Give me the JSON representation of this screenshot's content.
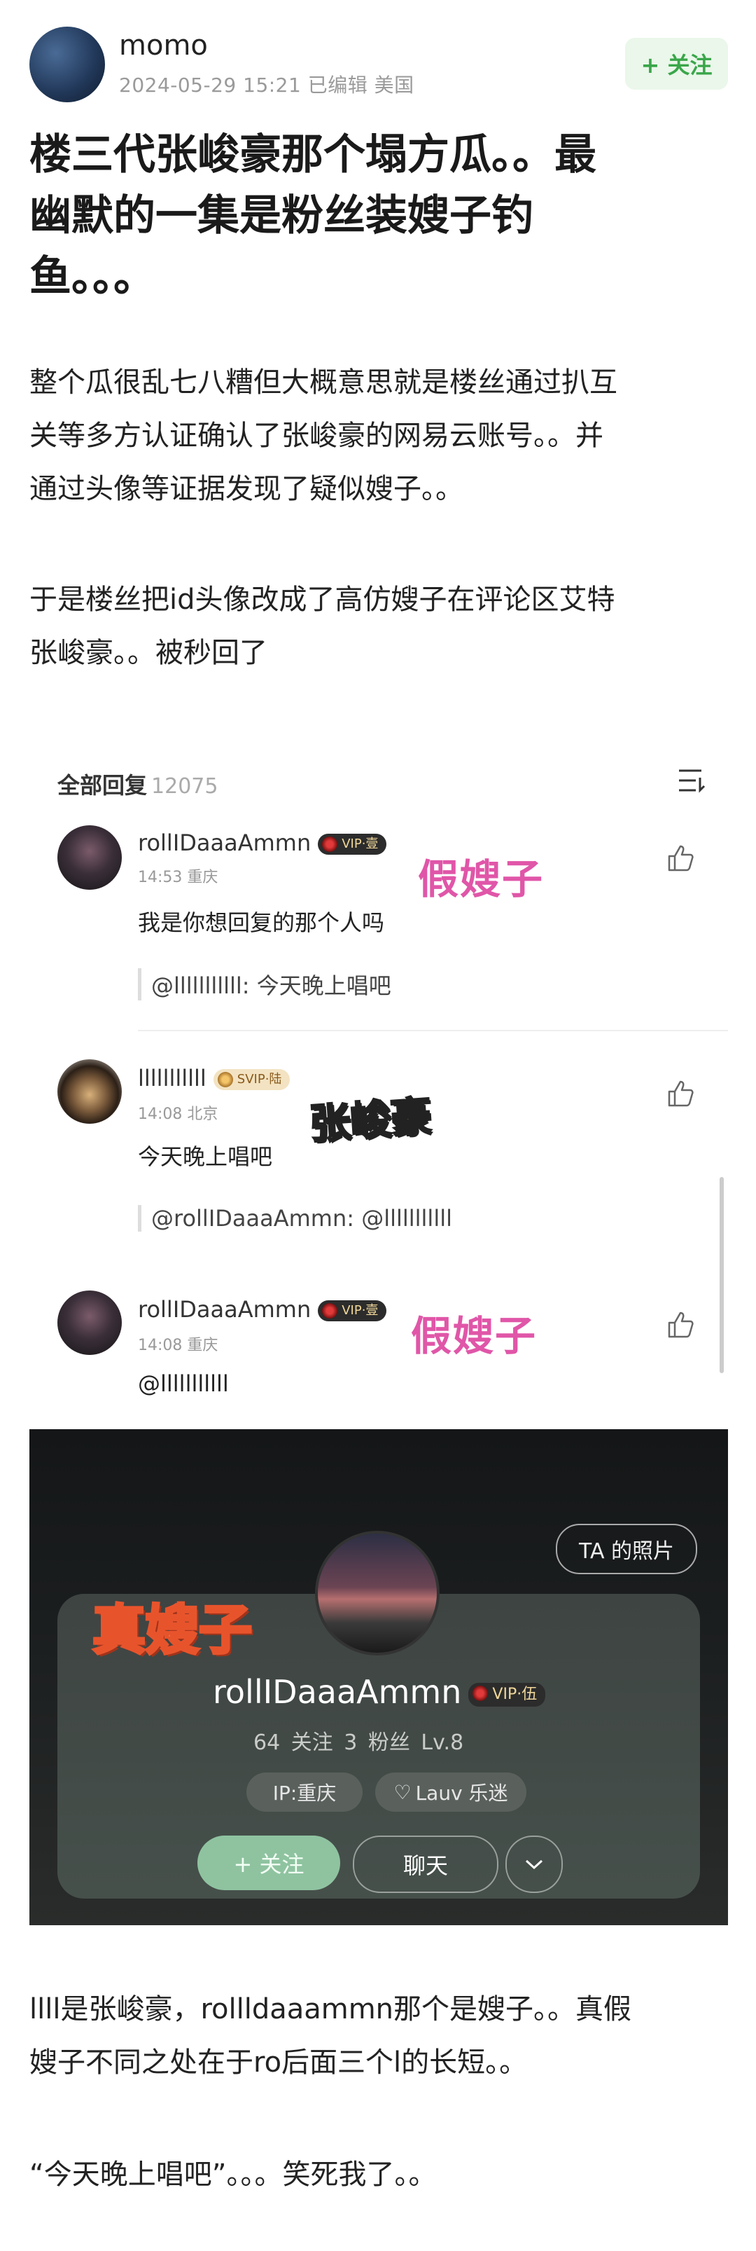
{
  "header": {
    "username": "momo",
    "meta": "2024-05-29 15:21 已编辑 美国",
    "follow_label": "+ 关注"
  },
  "post": {
    "title_lines": [
      "楼三代张峻豪那个塌方瓜。。最",
      "幽默的一集是粉丝装嫂子钓",
      "鱼。。。"
    ],
    "para1_lines": [
      "整个瓜很乱七八糟但大概意思就是楼丝通过扒互",
      "关等多方认证确认了张峻豪的网易云账号。。并",
      "通过头像等证据发现了疑似嫂子。。"
    ],
    "para2_lines": [
      "于是楼丝把id头像改成了高仿嫂子在评论区艾特",
      "张峻豪。。被秒回了"
    ],
    "para3_lines": [
      "llll是张峻豪，rollldaaammn那个是嫂子。。真假",
      "嫂子不同之处在于ro后面三个l的长短。。"
    ],
    "para4": "“今天晚上唱吧”。。。笑死我了。。"
  },
  "comments": {
    "header_label": "全部回复",
    "count": "12075",
    "items": [
      {
        "name": "rollIDaaaAmmn",
        "vip": "VIP·壹",
        "time": "14:53 重庆",
        "text": "我是你想回复的那个人吗",
        "quote": "@lllllllllll: 今天晚上唱吧",
        "tag": "假嫂子"
      },
      {
        "name": "lllllllllll",
        "vip": "SVIP·陆",
        "time": "14:08 北京",
        "text": "今天晚上唱吧",
        "quote": "@rollIDaaaAmmn: @lllllllllll",
        "tag": "张峻豪"
      },
      {
        "name": "rollIDaaaAmmn",
        "vip": "VIP·壹",
        "time": "14:08 重庆",
        "text": "@lllllllllll",
        "quote": "",
        "tag": "假嫂子"
      }
    ]
  },
  "profile": {
    "photo_button": "TA 的照片",
    "tag": "真嫂子",
    "name": "rollIDaaaAmmn",
    "vip": "VIP·伍",
    "stats": "64 关注   3 粉丝   Lv.8",
    "chip_ip": "IP:重庆",
    "chip_fan": "Lauv 乐迷",
    "follow": "+ 关注",
    "chat": "聊天"
  },
  "colors": {
    "accent_green": "#3aa64a",
    "tag_pink": "#e056a8"
  }
}
